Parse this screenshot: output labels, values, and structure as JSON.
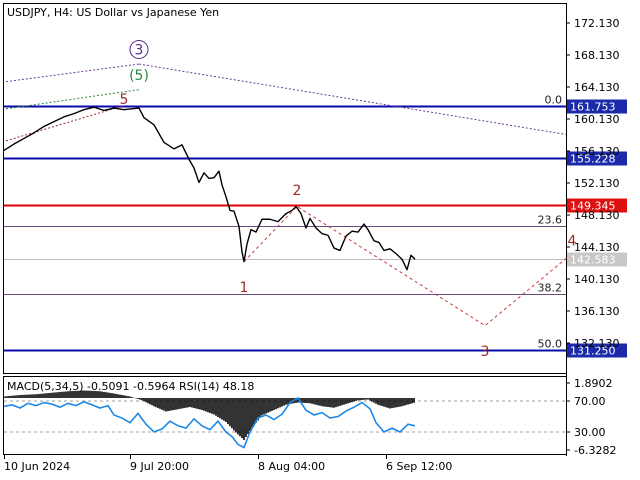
{
  "chart_data": {
    "type": "line",
    "title": "USDJPY, H4:  US Dollar vs Japanese Yen",
    "price_axis": {
      "ylim": [
        127.0,
        175.0
      ],
      "ticks": [
        "172.130",
        "168.130",
        "164.130",
        "160.130",
        "156.130",
        "152.130",
        "148.130",
        "144.130",
        "140.130",
        "136.130",
        "132.130"
      ]
    },
    "time_axis": {
      "labels": [
        "10 Jun 2024",
        "9 Jul 20:00",
        "8 Aug 04:00",
        "6 Sep 12:00"
      ]
    },
    "price_series": {
      "name": "USDJPY",
      "color": "#000000",
      "path": [
        [
          0,
          156.2
        ],
        [
          10,
          157.0
        ],
        [
          20,
          157.7
        ],
        [
          30,
          158.4
        ],
        [
          40,
          159.2
        ],
        [
          50,
          159.8
        ],
        [
          60,
          160.4
        ],
        [
          70,
          160.8
        ],
        [
          80,
          161.3
        ],
        [
          90,
          161.6
        ],
        [
          100,
          161.2
        ],
        [
          110,
          161.5
        ],
        [
          120,
          161.3
        ],
        [
          135,
          161.5
        ],
        [
          140,
          160.3
        ],
        [
          150,
          159.4
        ],
        [
          160,
          157.2
        ],
        [
          170,
          156.4
        ],
        [
          178,
          156.9
        ],
        [
          185,
          155.1
        ],
        [
          190,
          154.0
        ],
        [
          195,
          152.2
        ],
        [
          200,
          153.4
        ],
        [
          205,
          152.7
        ],
        [
          210,
          152.8
        ],
        [
          215,
          153.6
        ],
        [
          218,
          151.9
        ],
        [
          222,
          150.4
        ],
        [
          226,
          148.7
        ],
        [
          230,
          148.6
        ],
        [
          235,
          146.7
        ],
        [
          238,
          143.5
        ],
        [
          240,
          142.3
        ],
        [
          243,
          144.5
        ],
        [
          247,
          146.3
        ],
        [
          252,
          146.0
        ],
        [
          258,
          147.6
        ],
        [
          266,
          147.6
        ],
        [
          274,
          147.3
        ],
        [
          282,
          148.3
        ],
        [
          288,
          148.7
        ],
        [
          292,
          149.2
        ],
        [
          297,
          148.3
        ],
        [
          302,
          146.5
        ],
        [
          306,
          147.7
        ],
        [
          312,
          146.5
        ],
        [
          318,
          145.8
        ],
        [
          324,
          145.6
        ],
        [
          330,
          144.0
        ],
        [
          336,
          143.7
        ],
        [
          342,
          145.5
        ],
        [
          348,
          146.1
        ],
        [
          354,
          146.0
        ],
        [
          360,
          147.0
        ],
        [
          364,
          146.3
        ],
        [
          370,
          144.9
        ],
        [
          375,
          144.7
        ],
        [
          380,
          143.7
        ],
        [
          386,
          143.9
        ],
        [
          392,
          143.3
        ],
        [
          398,
          142.6
        ],
        [
          403,
          141.3
        ],
        [
          407,
          143.1
        ],
        [
          411,
          142.6
        ]
      ]
    },
    "levels": [
      {
        "price": 161.753,
        "label": "161.753",
        "fib": "0.0",
        "line_color": "#0a0aa8",
        "tag_color": "#1a2aa8"
      },
      {
        "price": 155.228,
        "label": "155.228",
        "line_color": "#0a0aa8",
        "tag_color": "#1a2aa8"
      },
      {
        "price": 149.345,
        "label": "149.345",
        "line_color": "#e00000",
        "tag_color": "#dd1111"
      },
      {
        "price": 146.8,
        "fib": "23.6",
        "line_color": "#6a4a7a"
      },
      {
        "price": 138.3,
        "fib": "38.2",
        "line_color": "#6a4a7a"
      },
      {
        "price": 131.25,
        "label": "131.250",
        "fib": "50.0",
        "line_color": "#0a0aa8",
        "tag_color": "#1a2aa8"
      }
    ],
    "current_price": {
      "label": "142.583",
      "price": 142.583,
      "tag_color": "#c8c8c8"
    },
    "wave_labels": [
      {
        "text": "3",
        "circled": true,
        "color": "#5a2a8a",
        "t": 135,
        "price": 168.2
      },
      {
        "text": "(5)",
        "color": "#2a8a3a",
        "t": 135,
        "price": 165.0
      },
      {
        "text": "5",
        "color": "#9a2a2a",
        "t": 120,
        "price": 162.0
      },
      {
        "text": "1",
        "color": "#9a2a2a",
        "t": 240,
        "price": 138.5
      },
      {
        "text": "2",
        "color": "#9a2a2a",
        "t": 293,
        "price": 150.6
      },
      {
        "text": "3",
        "color": "#9a2a2a",
        "t": 481,
        "price": 130.5
      },
      {
        "text": "4",
        "color": "#9a2a2a",
        "t": 568,
        "price": 144.3
      }
    ],
    "projection_path": [
      [
        240,
        142.3
      ],
      [
        293,
        149.2
      ],
      [
        481,
        134.3
      ],
      [
        568,
        143.3
      ]
    ],
    "indicator": {
      "label": "MACD(5,34,5) -0.5091 -0.5964 RSI(14) 48.18",
      "ticks": [
        "1.8902",
        "70.00",
        "30.00",
        "-6.3282"
      ],
      "rsi_levels": [
        70,
        30
      ],
      "rsi_color": "#1e88e5",
      "rsi": [
        [
          0,
          63
        ],
        [
          8,
          65
        ],
        [
          16,
          61
        ],
        [
          24,
          67
        ],
        [
          32,
          64
        ],
        [
          40,
          68
        ],
        [
          48,
          66
        ],
        [
          56,
          62
        ],
        [
          64,
          67
        ],
        [
          72,
          64
        ],
        [
          80,
          69
        ],
        [
          88,
          65
        ],
        [
          96,
          61
        ],
        [
          104,
          64
        ],
        [
          110,
          52
        ],
        [
          118,
          48
        ],
        [
          126,
          42
        ],
        [
          134,
          54
        ],
        [
          142,
          40
        ],
        [
          150,
          30
        ],
        [
          158,
          34
        ],
        [
          166,
          44
        ],
        [
          174,
          38
        ],
        [
          182,
          35
        ],
        [
          190,
          47
        ],
        [
          198,
          38
        ],
        [
          206,
          33
        ],
        [
          214,
          44
        ],
        [
          222,
          30
        ],
        [
          228,
          24
        ],
        [
          234,
          14
        ],
        [
          240,
          10
        ],
        [
          246,
          30
        ],
        [
          254,
          48
        ],
        [
          262,
          52
        ],
        [
          270,
          46
        ],
        [
          278,
          53
        ],
        [
          286,
          68
        ],
        [
          294,
          74
        ],
        [
          302,
          58
        ],
        [
          310,
          52
        ],
        [
          318,
          55
        ],
        [
          326,
          48
        ],
        [
          334,
          50
        ],
        [
          342,
          57
        ],
        [
          350,
          62
        ],
        [
          358,
          68
        ],
        [
          366,
          60
        ],
        [
          372,
          42
        ],
        [
          380,
          30
        ],
        [
          388,
          35
        ],
        [
          396,
          30
        ],
        [
          404,
          40
        ],
        [
          411,
          38
        ]
      ],
      "macd": [
        [
          0,
          0.2
        ],
        [
          16,
          0.4
        ],
        [
          32,
          0.5
        ],
        [
          48,
          0.7
        ],
        [
          64,
          0.9
        ],
        [
          80,
          1.0
        ],
        [
          96,
          0.9
        ],
        [
          110,
          0.6
        ],
        [
          126,
          0.2
        ],
        [
          138,
          -0.3
        ],
        [
          150,
          -1.1
        ],
        [
          162,
          -1.8
        ],
        [
          174,
          -1.5
        ],
        [
          186,
          -1.2
        ],
        [
          198,
          -1.6
        ],
        [
          210,
          -2.2
        ],
        [
          222,
          -3.2
        ],
        [
          232,
          -4.6
        ],
        [
          240,
          -5.6
        ],
        [
          248,
          -4.0
        ],
        [
          258,
          -2.3
        ],
        [
          270,
          -1.6
        ],
        [
          282,
          -0.9
        ],
        [
          294,
          -0.6
        ],
        [
          306,
          -0.7
        ],
        [
          318,
          -1.1
        ],
        [
          330,
          -1.3
        ],
        [
          342,
          -0.8
        ],
        [
          354,
          -0.3
        ],
        [
          364,
          -0.2
        ],
        [
          374,
          -0.9
        ],
        [
          386,
          -1.4
        ],
        [
          398,
          -1.1
        ],
        [
          411,
          -0.6
        ]
      ]
    }
  }
}
